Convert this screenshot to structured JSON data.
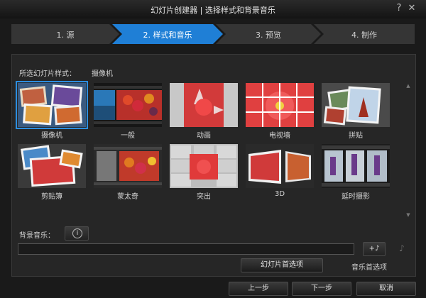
{
  "window": {
    "title": "幻灯片创建器 | 选择样式和背景音乐",
    "help": "?",
    "close": "✕"
  },
  "steps": [
    {
      "label": "1. 源",
      "active": false
    },
    {
      "label": "2. 样式和音乐",
      "active": true
    },
    {
      "label": "3. 预览",
      "active": false
    },
    {
      "label": "4. 制作",
      "active": false
    }
  ],
  "style_section": {
    "label": "所选幻灯片样式：",
    "value": "摄像机"
  },
  "styles": [
    {
      "name": "摄像机",
      "selected": true
    },
    {
      "name": "一般",
      "selected": false
    },
    {
      "name": "动画",
      "selected": false
    },
    {
      "name": "电视墙",
      "selected": false
    },
    {
      "name": "拼贴",
      "selected": false
    },
    {
      "name": "剪贴簿",
      "selected": false
    },
    {
      "name": "蒙太奇",
      "selected": false
    },
    {
      "name": "突出",
      "selected": false
    },
    {
      "name": "3D",
      "selected": false
    },
    {
      "name": "延时摄影",
      "selected": false
    }
  ],
  "music": {
    "label": "背景音乐：",
    "info_icon": "i",
    "file": "",
    "add_label": "+♪",
    "remove_icon": "♪"
  },
  "buttons": {
    "slideshow_prefs": "幻灯片首选项",
    "music_prefs": "音乐首选项",
    "back": "上一步",
    "next": "下一步",
    "cancel": "取消"
  },
  "colors": {
    "accent": "#2c8ee0",
    "step_active": "#1f7fd6",
    "step_inactive": "#353535"
  }
}
